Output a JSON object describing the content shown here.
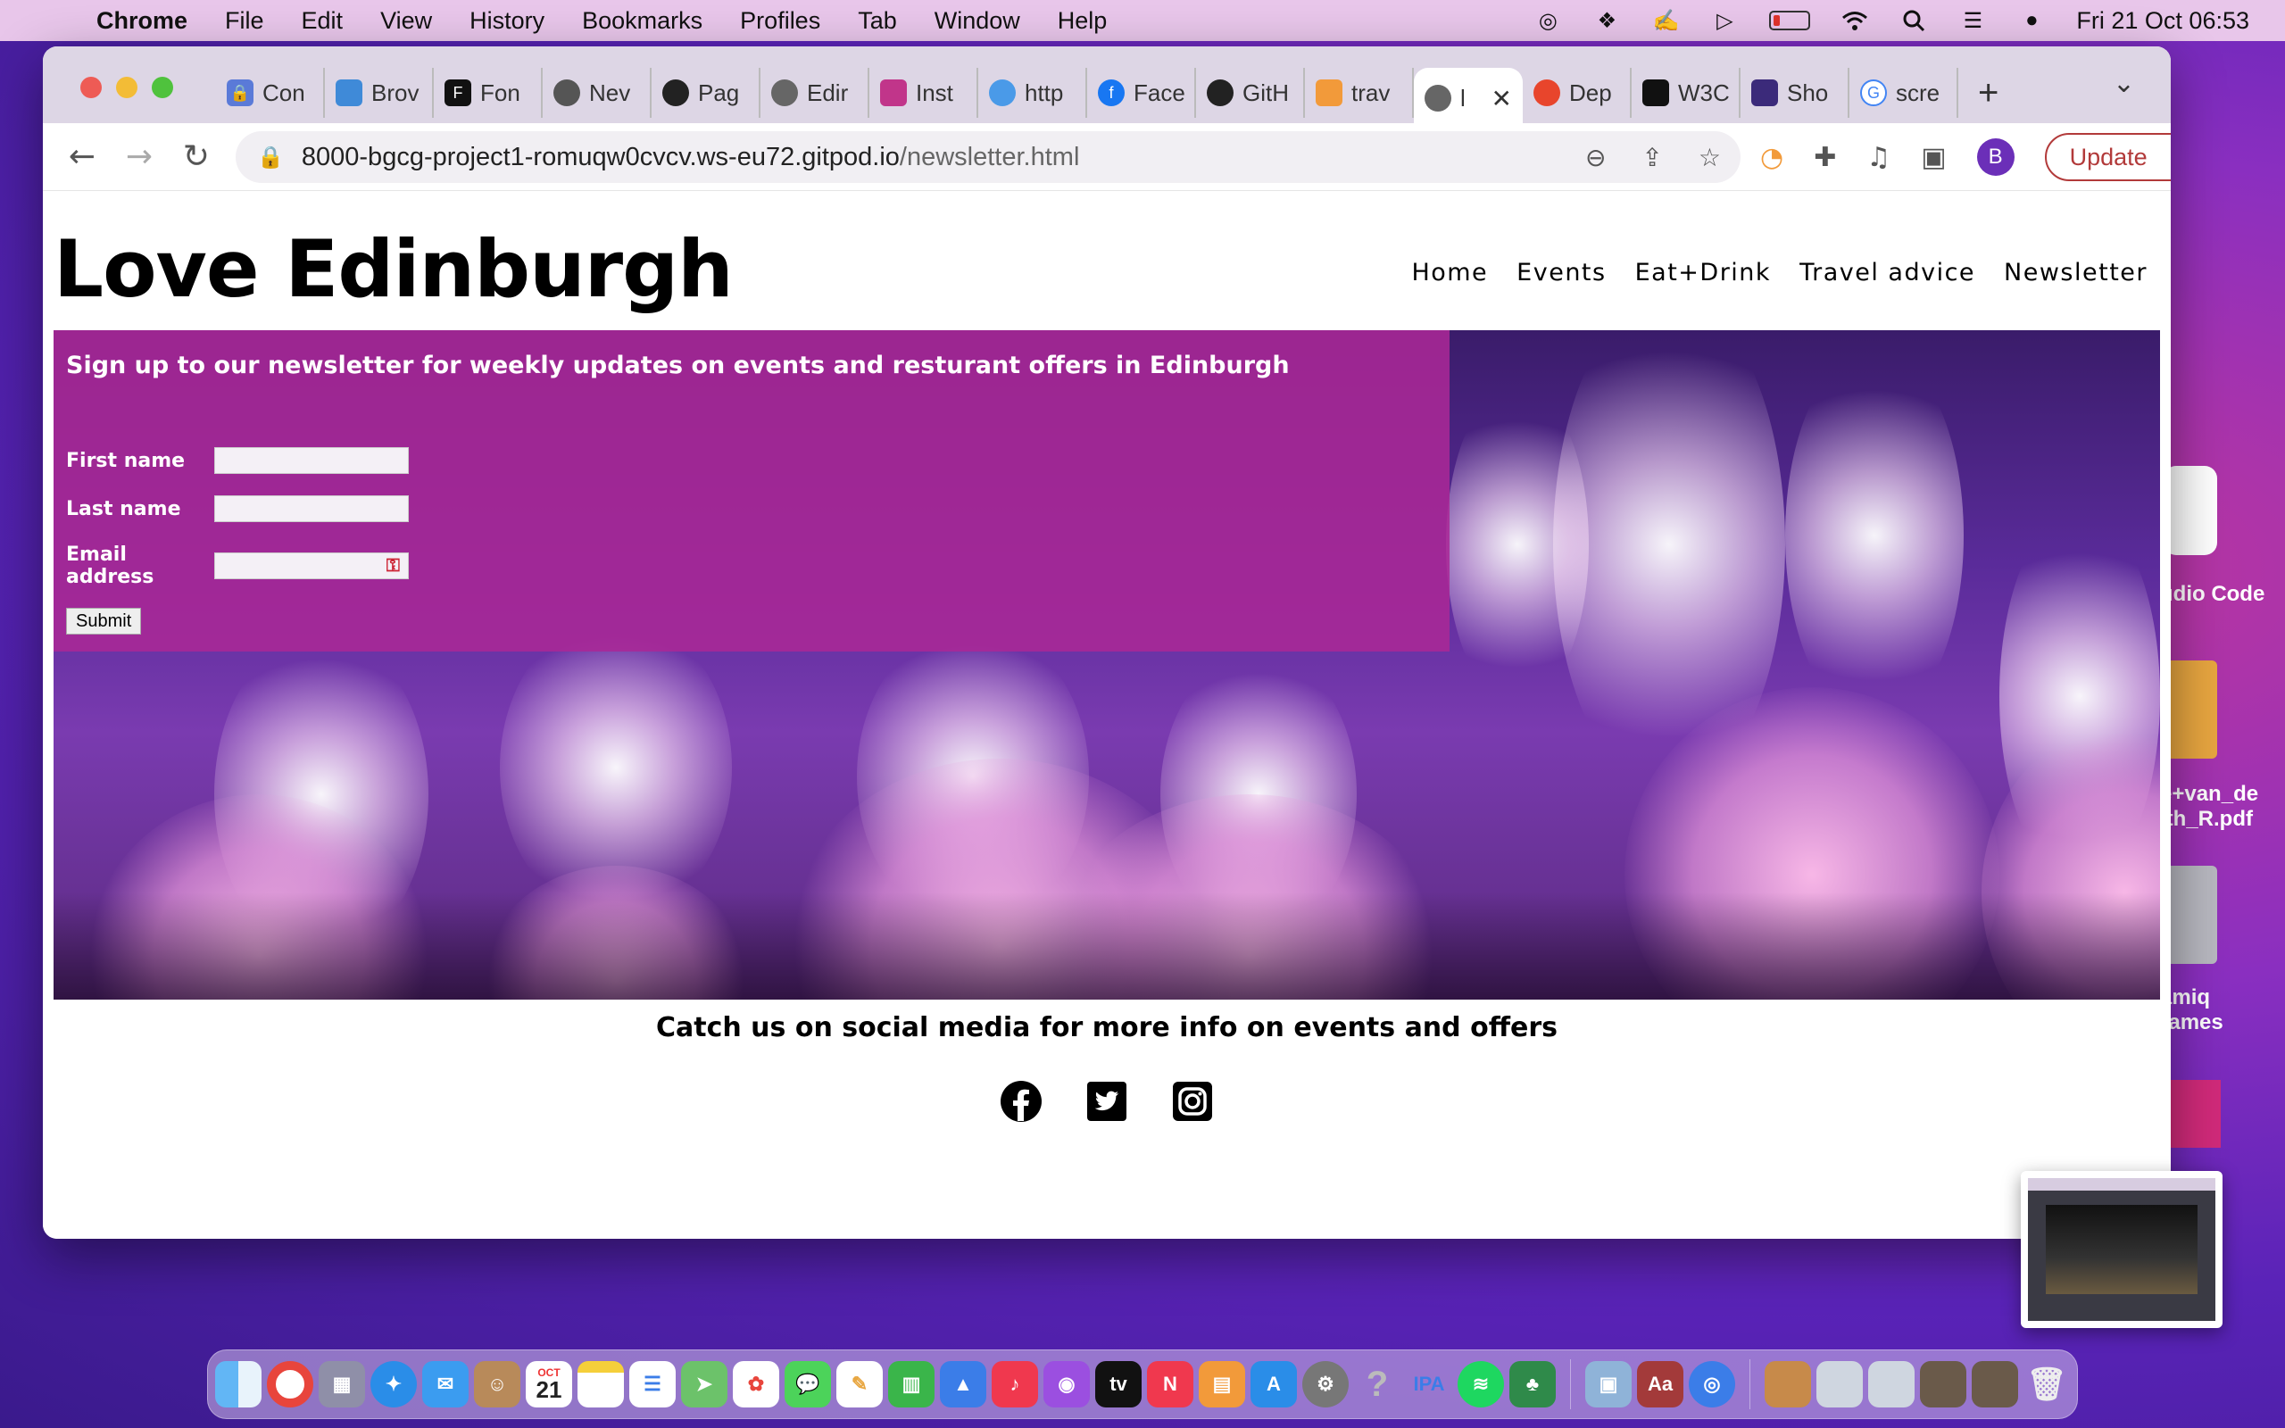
{
  "menubar": {
    "app": "Chrome",
    "items": [
      "File",
      "Edit",
      "View",
      "History",
      "Bookmarks",
      "Profiles",
      "Tab",
      "Window",
      "Help"
    ],
    "clock": "Fri 21 Oct  06:53"
  },
  "desktop": {
    "items": [
      "udio Code",
      "e+van_de\n.th_R.pdf",
      "amiq\nrames"
    ]
  },
  "browser": {
    "tabs": [
      "Con",
      "Brov",
      "Fon",
      "Nev",
      "Pag",
      "Edir",
      "Inst",
      "http",
      "Face",
      "GitH",
      "trav",
      "l",
      "Dep",
      "W3C",
      "Sho",
      "scre"
    ],
    "url_host": "8000-bgcg-project1-romuqw0cvcv.ws-eu72.gitpod.io",
    "url_path": "/newsletter.html",
    "profile_initial": "B",
    "update_label": "Update"
  },
  "site": {
    "title": "Love Edinburgh",
    "nav": [
      "Home",
      "Events",
      "Eat+Drink",
      "Travel advice",
      "Newsletter"
    ],
    "form": {
      "heading": "Sign up to our newsletter for weekly updates on events and resturant offers in Edinburgh",
      "first_name_label": "First name",
      "last_name_label": "Last name",
      "email_label": "Email address",
      "submit_label": "Submit"
    },
    "social_heading": "Catch us on social media for more info on events and offers",
    "social_icons": [
      "facebook-icon",
      "twitter-icon",
      "instagram-icon"
    ]
  },
  "dock": {
    "calendar_month": "OCT",
    "calendar_day": "21",
    "ipa_label": "IPA"
  }
}
